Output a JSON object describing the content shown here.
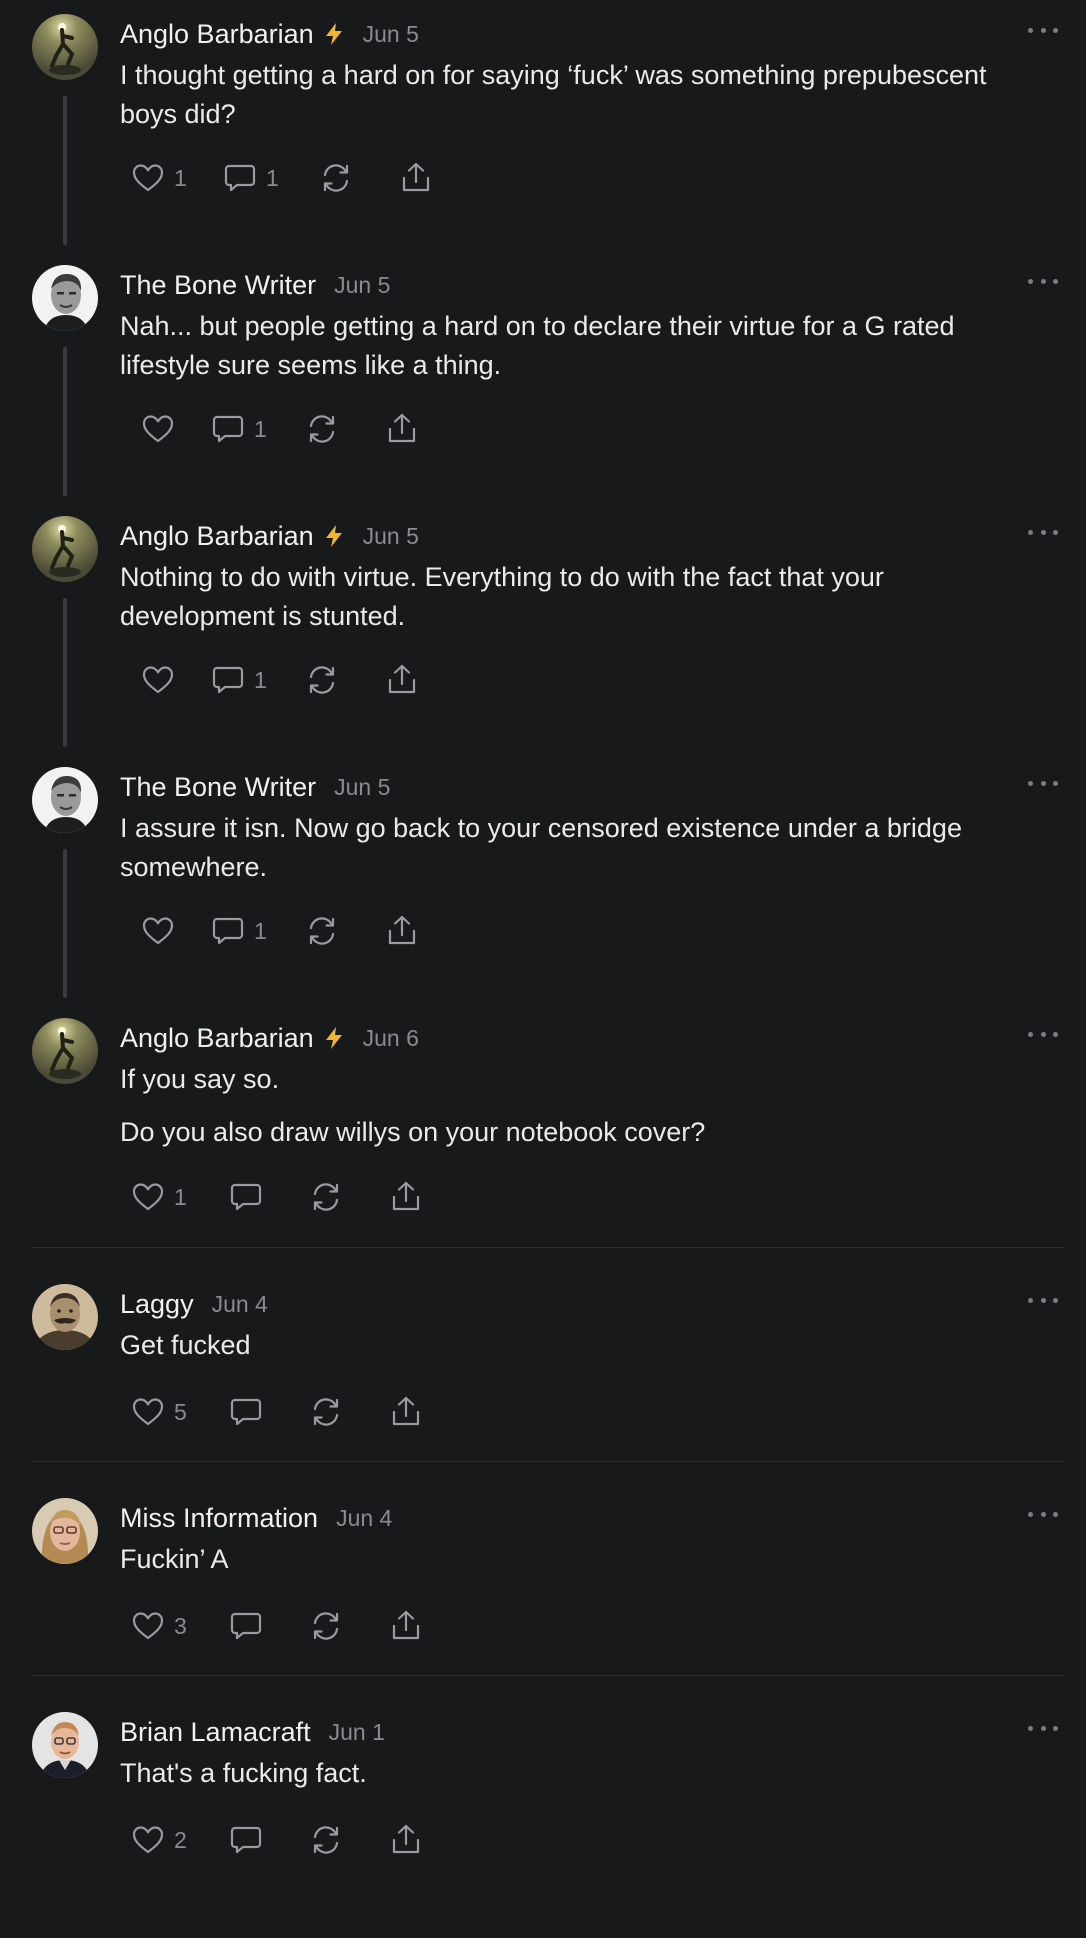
{
  "comments": [
    {
      "author": "Anglo Barbarian",
      "date": "Jun 5",
      "paragraphs": [
        "I thought getting a hard on for saying ‘fuck’ was something prepubescent boys did?"
      ],
      "likes": "1",
      "replies": "1",
      "avatar": "avatar-statue",
      "badge": true
    },
    {
      "author": "The Bone Writer",
      "date": "Jun 5",
      "paragraphs": [
        "Nah... but people getting a hard on to declare their virtue for a G rated lifestyle sure seems like a thing."
      ],
      "likes": "",
      "replies": "1",
      "avatar": "avatar-man-bw",
      "badge": false
    },
    {
      "author": "Anglo Barbarian",
      "date": "Jun 5",
      "paragraphs": [
        "Nothing to do with virtue. Everything to do with the fact that your development is stunted."
      ],
      "likes": "",
      "replies": "1",
      "avatar": "avatar-statue",
      "badge": true
    },
    {
      "author": "The Bone Writer",
      "date": "Jun 5",
      "paragraphs": [
        "I assure it isn. Now go back to your censored existence under a bridge somewhere."
      ],
      "likes": "",
      "replies": "1",
      "avatar": "avatar-man-bw",
      "badge": false
    },
    {
      "author": "Anglo Barbarian",
      "date": "Jun 6",
      "paragraphs": [
        "If you say so.",
        "Do you also draw willys on your notebook cover?"
      ],
      "likes": "1",
      "replies": "",
      "avatar": "avatar-statue",
      "badge": true
    },
    {
      "author": "Laggy",
      "date": "Jun 4",
      "paragraphs": [
        "Get fucked"
      ],
      "likes": "5",
      "replies": "",
      "avatar": "avatar-sepia-man",
      "badge": false
    },
    {
      "author": "Miss Information",
      "date": "Jun 4",
      "paragraphs": [
        "Fuckin’ A"
      ],
      "likes": "3",
      "replies": "",
      "avatar": "avatar-woman",
      "badge": false
    },
    {
      "author": "Brian Lamacraft",
      "date": "Jun 1",
      "paragraphs": [
        "That's a fucking fact."
      ],
      "likes": "2",
      "replies": "",
      "avatar": "avatar-man-glasses",
      "badge": false
    }
  ],
  "icons": {
    "like": "heart-icon",
    "reply": "comment-bubble-icon",
    "restack": "restack-icon",
    "share": "share-icon",
    "more": "more-dots-icon",
    "badge": "lightning-bolt-icon"
  },
  "colors": {
    "background": "#18191b",
    "text": "#eaeaea",
    "muted": "#8a8b8f",
    "badge": "#f2b531",
    "thread": "#3a3b3e"
  }
}
